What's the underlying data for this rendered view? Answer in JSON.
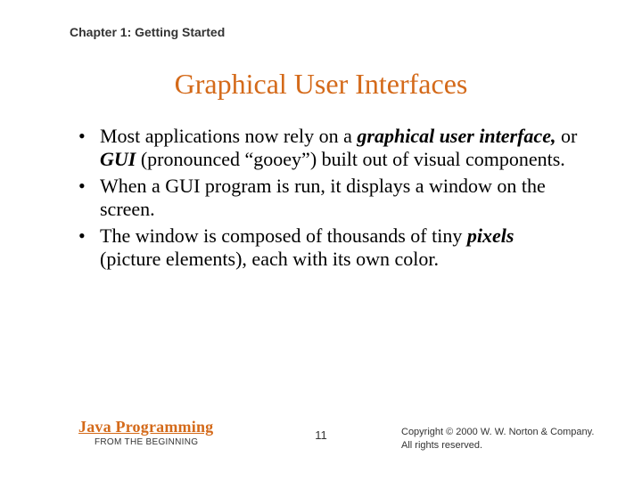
{
  "chapter": "Chapter 1: Getting Started",
  "title": "Graphical User Interfaces",
  "bullets": [
    {
      "pre": "Most applications now rely on a ",
      "em1": "graphical user interface,",
      "mid": " or ",
      "em2": "GUI",
      "post": " (pronounced “gooey”) built out of visual components."
    },
    {
      "text": "When a GUI program is run, it displays a window on the screen."
    },
    {
      "pre": "The window is composed of thousands of tiny ",
      "em1": "pixels",
      "post": " (picture elements), each with its own color."
    }
  ],
  "footer": {
    "brand": "Java Programming",
    "subbrand": "FROM THE BEGINNING",
    "page": "11",
    "copyright_line1": "Copyright © 2000 W. W. Norton & Company.",
    "copyright_line2": "All rights reserved."
  }
}
